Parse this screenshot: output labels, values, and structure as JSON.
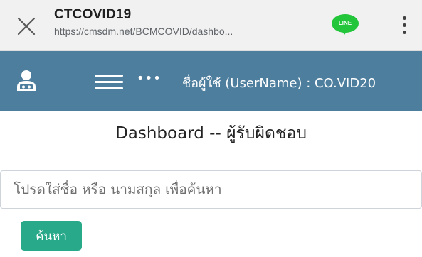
{
  "browser": {
    "title": "CTCOVID19",
    "url": "https://cmsdm.net/BCMCOVID/dashbo...",
    "line_label": "LINE"
  },
  "navbar": {
    "more_label": "•••",
    "username_text": "ชื่อผู้ใช้ (UserName) : CO.VID20"
  },
  "main": {
    "title": "Dashboard -- ผู้รับผิดชอบ",
    "search_placeholder": "โปรดใส่ชื่อ หรือ นามสกุล เพื่อค้นหา",
    "search_value": "",
    "search_button_label": "ค้นหา"
  },
  "colors": {
    "navbar_bg": "#4d7e9e",
    "browser_bar_bg": "#f1f1f1",
    "search_button_bg": "#28a98a",
    "line_green": "#23c53b"
  },
  "icons": {
    "close": "close-icon",
    "line": "line-app-icon",
    "overflow_menu": "kebab-menu-icon",
    "user": "user-icon",
    "hamburger": "hamburger-menu-icon"
  }
}
